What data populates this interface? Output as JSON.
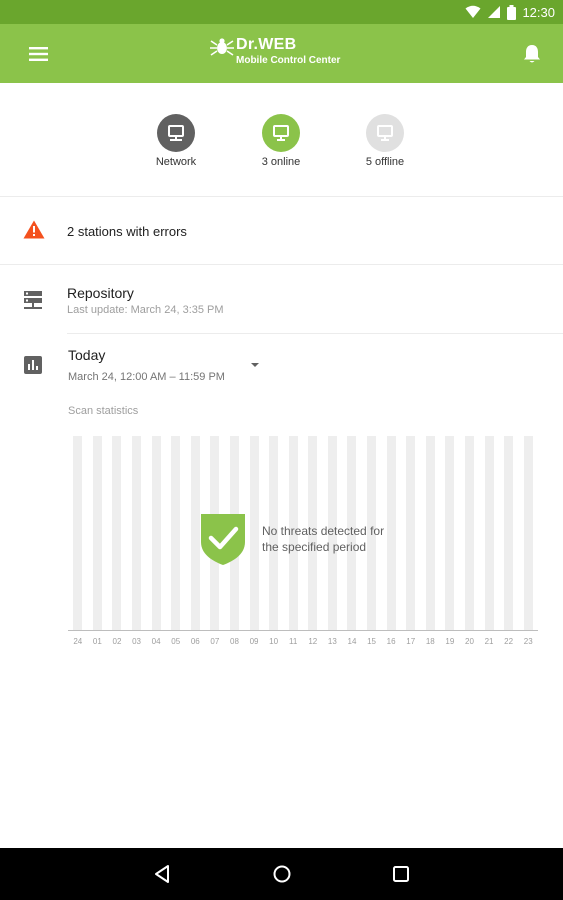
{
  "status_bar": {
    "time": "12:30"
  },
  "app_bar": {
    "brand_title": "Dr.WEB",
    "brand_subtitle": "Mobile Control Center"
  },
  "status": [
    {
      "label": "Network",
      "color": "#616161"
    },
    {
      "label": "3 online",
      "color": "#8bc34a"
    },
    {
      "label": "5 offline",
      "color": "#e0e0e0"
    }
  ],
  "errors": {
    "text": "2 stations with errors",
    "color": "#f4511e"
  },
  "repository": {
    "title": "Repository",
    "subtitle": "Last update: March 24, 3:35 PM"
  },
  "today": {
    "title": "Today",
    "range": "March 24, 12:00 AM – 11:59 PM"
  },
  "scan": {
    "label": "Scan statistics",
    "message": "No threats detected for the specified period",
    "message_line1": "No threats detected for",
    "message_line2": "the specified period"
  },
  "chart_data": {
    "type": "bar",
    "title": "Scan statistics",
    "categories": [
      "24",
      "01",
      "02",
      "03",
      "04",
      "05",
      "06",
      "07",
      "08",
      "09",
      "10",
      "11",
      "12",
      "13",
      "14",
      "15",
      "16",
      "17",
      "18",
      "19",
      "20",
      "21",
      "22",
      "23"
    ],
    "values": [
      0,
      0,
      0,
      0,
      0,
      0,
      0,
      0,
      0,
      0,
      0,
      0,
      0,
      0,
      0,
      0,
      0,
      0,
      0,
      0,
      0,
      0,
      0,
      0
    ],
    "grid": false
  },
  "colors": {
    "accent": "#8bc34a",
    "status_bar": "#6aa62d",
    "warning": "#f4511e"
  },
  "icons": {
    "menu": "menu-icon",
    "bell": "bell-icon",
    "network": "monitor-icon",
    "warning": "warning-icon",
    "repository": "server-icon",
    "stats": "bar-chart-icon",
    "shield": "shield-check-icon"
  }
}
